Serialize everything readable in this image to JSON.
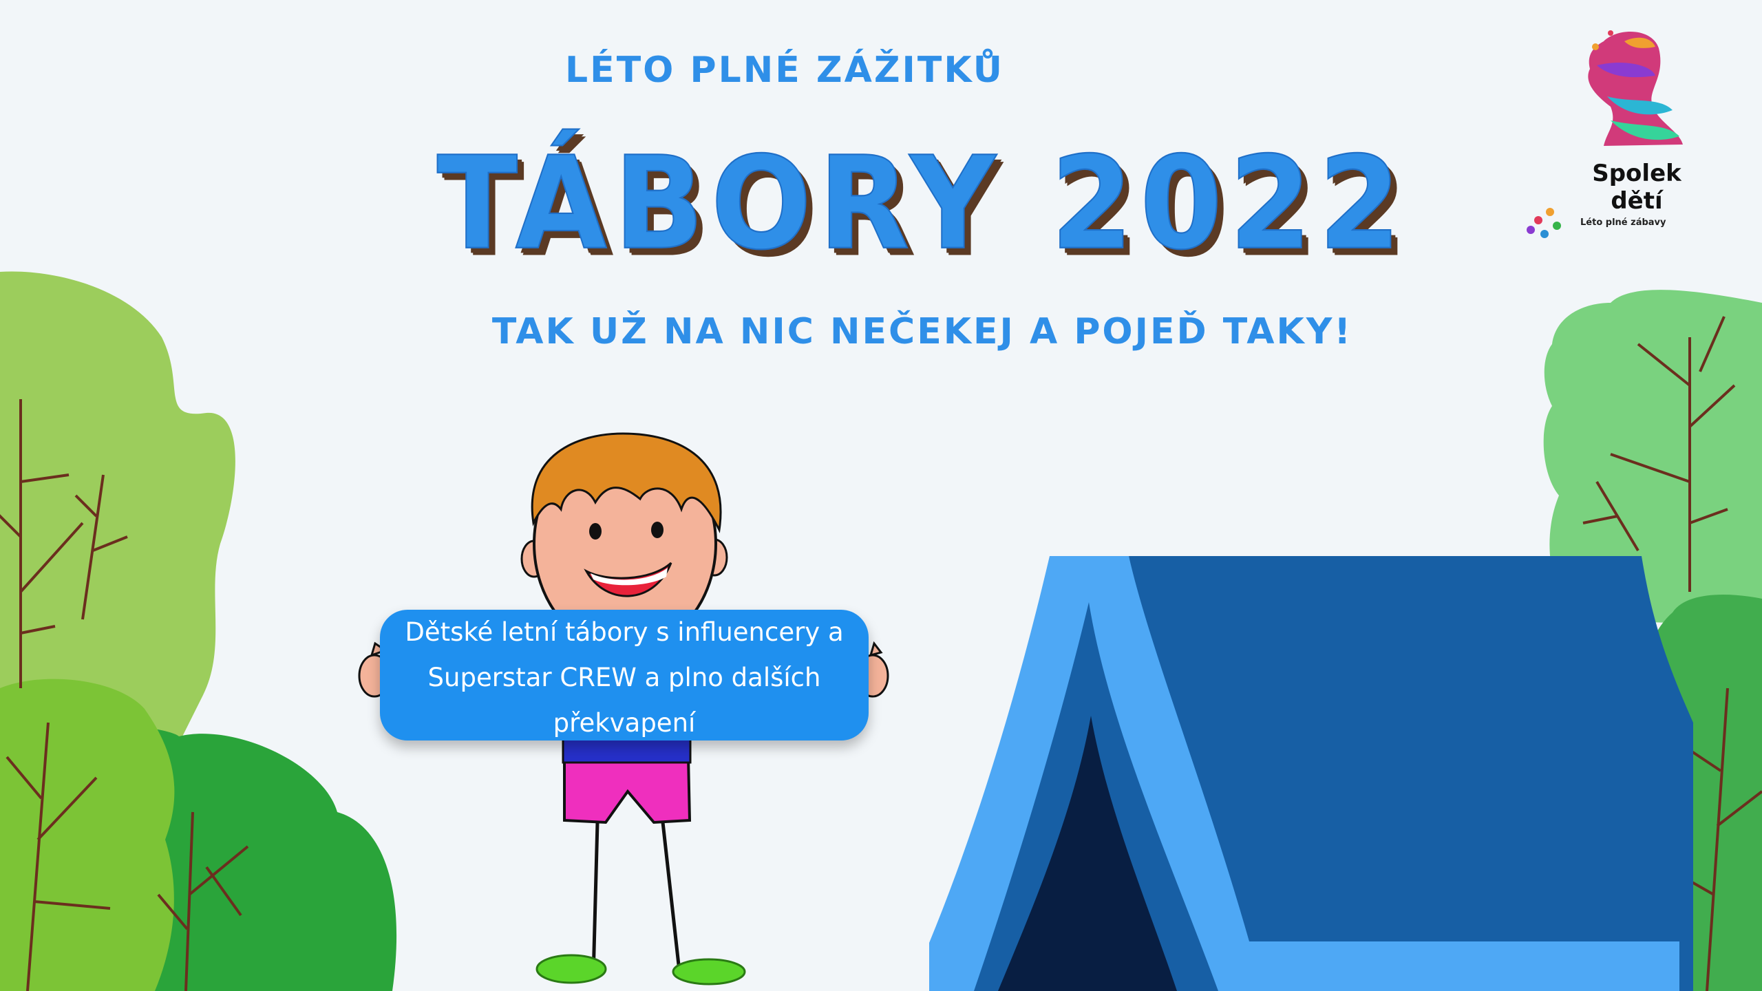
{
  "header": {
    "tagline": "LÉTO PLNÉ ZÁŽITKŮ",
    "title": "TÁBORY 2022",
    "subtitle": "TAK UŽ NA NIC NEČEKEJ A POJEĎ TAKY!"
  },
  "bubble": {
    "line1": "Dětské letní tábory s influencery a",
    "line2": "Superstar CREW a plno dalších",
    "line3": "překvapení"
  },
  "logo": {
    "name": "Spolek dětí",
    "small_text": "Léto plné zábavy"
  },
  "colors": {
    "background": "#f2f6f9",
    "accent_blue": "#2f8fe8",
    "title_shadow": "#5b3a24",
    "bubble": "#1f90ef",
    "tent_dark": "#175fa5",
    "tent_light": "#4ea8f5"
  }
}
